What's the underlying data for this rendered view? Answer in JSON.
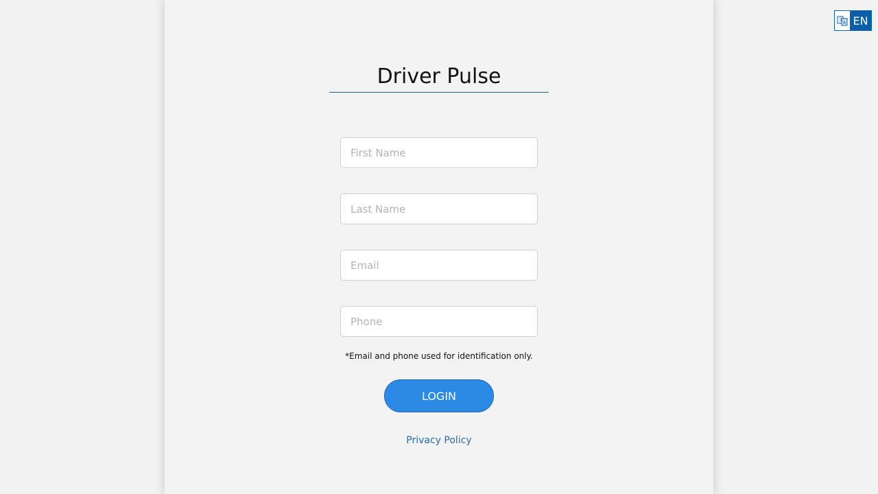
{
  "header": {
    "title": "Driver Pulse"
  },
  "language": {
    "code": "EN",
    "icon": "translate-icon"
  },
  "form": {
    "first_name": {
      "placeholder": "First Name",
      "value": ""
    },
    "last_name": {
      "placeholder": "Last Name",
      "value": ""
    },
    "email": {
      "placeholder": "Email",
      "value": ""
    },
    "phone": {
      "placeholder": "Phone",
      "value": ""
    },
    "note": "*Email and phone used for identification only.",
    "login_label": "LOGIN"
  },
  "footer": {
    "privacy_label": "Privacy Policy"
  },
  "colors": {
    "accent": "#2b8ae6",
    "language_bg": "#0b5ea8",
    "link": "#2a6aa6",
    "title_rule": "#1d5f94"
  }
}
